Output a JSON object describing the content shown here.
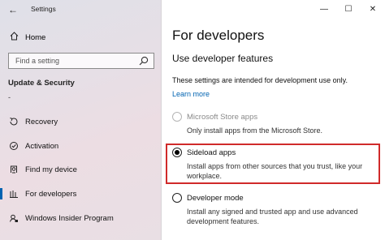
{
  "window": {
    "app_title": "Settings",
    "back_glyph": "←",
    "controls": {
      "minimize": "—",
      "maximize": "☐",
      "close": "✕"
    }
  },
  "sidebar": {
    "home_label": "Home",
    "search_placeholder": "Find a setting",
    "section_heading": "Update & Security",
    "dash_marker": "-",
    "items": [
      {
        "label": "Recovery",
        "icon": "recovery-icon"
      },
      {
        "label": "Activation",
        "icon": "activation-icon"
      },
      {
        "label": "Find my device",
        "icon": "find-device-icon"
      },
      {
        "label": "For developers",
        "icon": "developers-icon",
        "active": true
      },
      {
        "label": "Windows Insider Program",
        "icon": "insider-icon"
      }
    ]
  },
  "main": {
    "title": "For developers",
    "subtitle": "Use developer features",
    "description": "These settings are intended for development use only.",
    "learn_more": "Learn more",
    "options": [
      {
        "label": "Microsoft Store apps",
        "description": "Only install apps from the Microsoft Store.",
        "selected": false,
        "disabled": true
      },
      {
        "label": "Sideload apps",
        "description": "Install apps from other sources that you trust, like your workplace.",
        "selected": true,
        "disabled": false
      },
      {
        "label": "Developer mode",
        "description": "Install any signed and trusted app and use advanced development features.",
        "selected": false,
        "disabled": false
      }
    ]
  },
  "colors": {
    "accent": "#0063b1",
    "highlight": "#d02a2a"
  }
}
